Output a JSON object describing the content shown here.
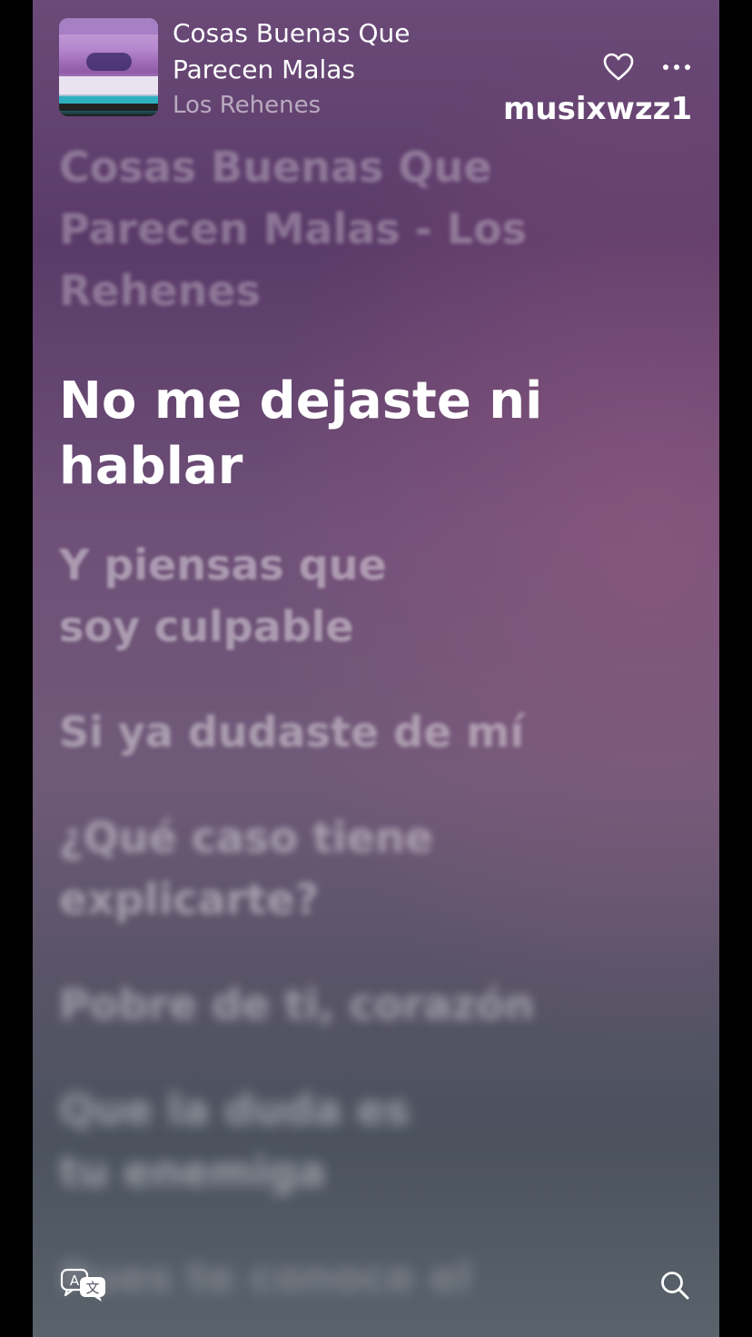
{
  "now_playing": {
    "title": "Cosas Buenas Que Parecen Malas",
    "artist": "Los Rehenes"
  },
  "watermark": "musixwzz1",
  "icons": {
    "favorite": "heart-icon",
    "more": "more-icon",
    "translate": "translate-icon",
    "search": "search-icon"
  },
  "lyrics": {
    "previous": "Cosas Buenas Que Parecen Malas - Los Rehenes",
    "current": "No me dejaste ni hablar",
    "upcoming": [
      "Y piensas que soy culpable",
      "Si ya dudaste de mí",
      "¿Qué caso tiene explicarte?",
      "Pobre de ti, corazón",
      "Que la duda es tu enemiga",
      "Pues te conoce el"
    ]
  },
  "colors": {
    "background_top": "#6b4a78",
    "background_bottom": "#5a626b",
    "text_primary": "#ffffff"
  }
}
